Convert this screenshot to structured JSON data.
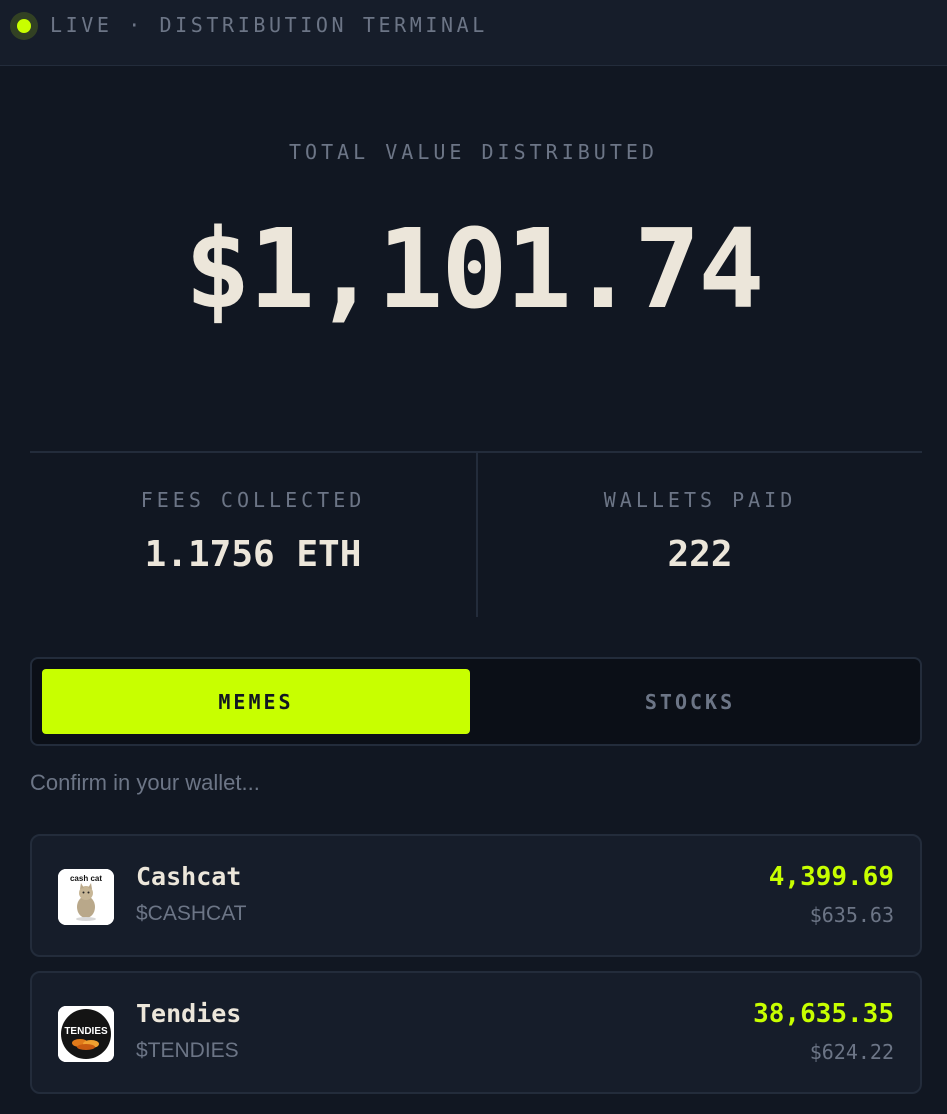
{
  "topbar": {
    "title": "LIVE · DISTRIBUTION TERMINAL"
  },
  "hero": {
    "label": "TOTAL VALUE DISTRIBUTED",
    "value": "$1,101.74"
  },
  "stats": [
    {
      "label": "FEES COLLECTED",
      "value": "1.1756 ETH"
    },
    {
      "label": "WALLETS PAID",
      "value": "222"
    }
  ],
  "tabs": [
    {
      "label": "MEMES",
      "active": true
    },
    {
      "label": "STOCKS",
      "active": false
    }
  ],
  "status": {
    "text": "Confirm in your wallet..."
  },
  "tokens": [
    {
      "name": "Cashcat",
      "ticker": "$CASHCAT",
      "amount": "4,399.69",
      "usd": "$635.63",
      "logo_text": "cash cat",
      "icon": "cat-logo"
    },
    {
      "name": "Tendies",
      "ticker": "$TENDIES",
      "amount": "38,635.35",
      "usd": "$624.22",
      "logo_text": "TENDIES",
      "icon": "tendies-logo"
    }
  ],
  "colors": {
    "accent": "#c8ff00",
    "background": "#111722",
    "card": "#161d2a",
    "muted": "#6c7586",
    "text": "#ece6da"
  }
}
